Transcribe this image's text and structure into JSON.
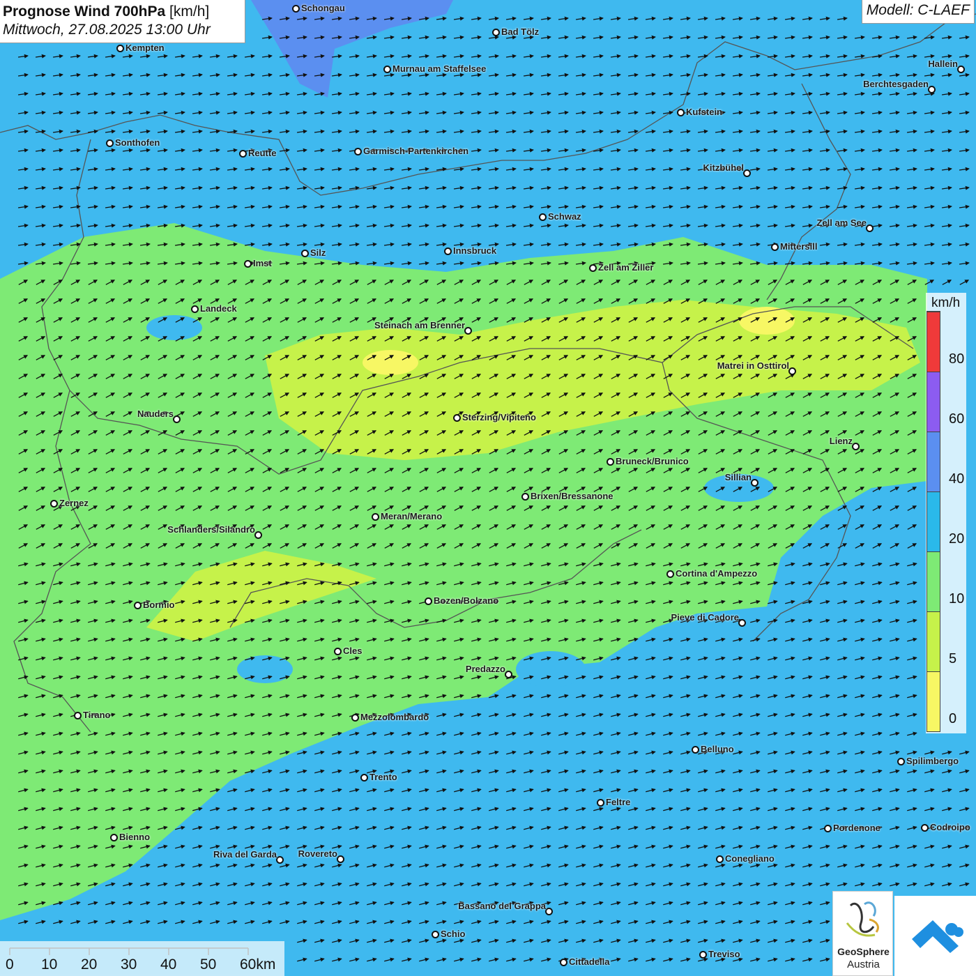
{
  "header": {
    "title_bold": "Prognose Wind 700hPa",
    "title_unit": "[km/h]",
    "datetime": "Mittwoch, 27.08.2025 13:00 Uhr",
    "model": "Modell: C-LAEF"
  },
  "legend": {
    "unit": "km/h",
    "ticks": [
      "0",
      "5",
      "10",
      "20",
      "40",
      "60",
      "80"
    ],
    "colors": [
      "#f7f764",
      "#c6f24a",
      "#7eea75",
      "#2ab9ea",
      "#5b8ff0",
      "#8c5cf0",
      "#ef3a3a"
    ]
  },
  "scale": {
    "labels": [
      "0",
      "10",
      "20",
      "30",
      "40",
      "50",
      "60km"
    ]
  },
  "logos": {
    "geosphere_line1": "GeoSphere",
    "geosphere_line2": "Austria"
  },
  "cities": [
    {
      "name": "Schongau",
      "label_side": "right"
    },
    {
      "name": "Bad Tölz",
      "label_side": "right"
    },
    {
      "name": "Kempten",
      "label_side": "right"
    },
    {
      "name": "Murnau am Staffelsee",
      "label_side": "right"
    },
    {
      "name": "Hallein",
      "label_side": "left"
    },
    {
      "name": "Berchtesgaden",
      "label_side": "left"
    },
    {
      "name": "Kufstein",
      "label_side": "right"
    },
    {
      "name": "Sonthofen",
      "label_side": "right"
    },
    {
      "name": "Reutte",
      "label_side": "right"
    },
    {
      "name": "Garmisch-Partenkirchen",
      "label_side": "right"
    },
    {
      "name": "Kitzbühel",
      "label_side": "left"
    },
    {
      "name": "Schwaz",
      "label_side": "right"
    },
    {
      "name": "Zell am See",
      "label_side": "left"
    },
    {
      "name": "Mittersill",
      "label_side": "right"
    },
    {
      "name": "Innsbruck",
      "label_side": "right"
    },
    {
      "name": "Silz",
      "label_side": "right"
    },
    {
      "name": "Imst",
      "label_side": "right"
    },
    {
      "name": "Zell am Ziller",
      "label_side": "right"
    },
    {
      "name": "Landeck",
      "label_side": "right"
    },
    {
      "name": "Steinach am Brenner",
      "label_side": "left"
    },
    {
      "name": "Matrei in Osttirol",
      "label_side": "left"
    },
    {
      "name": "Nauders",
      "label_side": "left"
    },
    {
      "name": "Sterzing/Vipiteno",
      "label_side": "right"
    },
    {
      "name": "Lienz",
      "label_side": "left"
    },
    {
      "name": "Bruneck/Brunico",
      "label_side": "right"
    },
    {
      "name": "Sillian",
      "label_side": "left"
    },
    {
      "name": "Brixen/Bressanone",
      "label_side": "right"
    },
    {
      "name": "Zernez",
      "label_side": "right"
    },
    {
      "name": "Meran/Merano",
      "label_side": "right"
    },
    {
      "name": "Schlanders/Silandro",
      "label_side": "left"
    },
    {
      "name": "Cortina d'Ampezzo",
      "label_side": "right"
    },
    {
      "name": "Bozen/Bolzano",
      "label_side": "right"
    },
    {
      "name": "Bormio",
      "label_side": "right"
    },
    {
      "name": "Pieve di Cadore",
      "label_side": "left"
    },
    {
      "name": "Cles",
      "label_side": "right"
    },
    {
      "name": "Predazzo",
      "label_side": "left"
    },
    {
      "name": "Tirano",
      "label_side": "right"
    },
    {
      "name": "Mezzolombardo",
      "label_side": "right"
    },
    {
      "name": "Belluno",
      "label_side": "right"
    },
    {
      "name": "Spilimbergo",
      "label_side": "right"
    },
    {
      "name": "Trento",
      "label_side": "right"
    },
    {
      "name": "Feltre",
      "label_side": "right"
    },
    {
      "name": "Pordenone",
      "label_side": "right"
    },
    {
      "name": "Codroipo",
      "label_side": "right"
    },
    {
      "name": "Bienno",
      "label_side": "right"
    },
    {
      "name": "Riva del Garda",
      "label_side": "left"
    },
    {
      "name": "Rovereto",
      "label_side": "left"
    },
    {
      "name": "Conegliano",
      "label_side": "right"
    },
    {
      "name": "Bassano del Grappa",
      "label_side": "left"
    },
    {
      "name": "Schio",
      "label_side": "right"
    },
    {
      "name": "Treviso",
      "label_side": "right"
    },
    {
      "name": "Cittadella",
      "label_side": "right"
    }
  ]
}
